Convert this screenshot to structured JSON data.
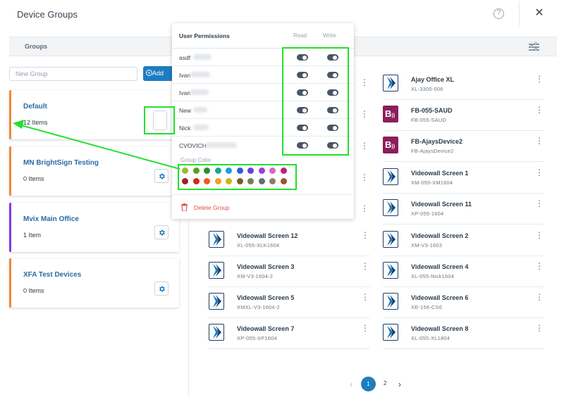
{
  "header": {
    "title": "Device Groups",
    "help_icon": "?",
    "close_icon": "✕"
  },
  "groups_band": {
    "label": "Groups"
  },
  "new_group": {
    "placeholder": "New Group",
    "add_label": "Add",
    "add_icon": "+"
  },
  "groups": [
    {
      "name": "Default",
      "count": "12 Items",
      "accent": "#f08a3c"
    },
    {
      "name": "MN BrightSign Testing",
      "count": "0 Items",
      "accent": "#f08a3c"
    },
    {
      "name": "Mvix Main Office",
      "count": "1 Item",
      "accent": "#7b3fe4"
    },
    {
      "name": "XFA Test Devices",
      "count": "0 Items",
      "accent": "#f08a3c"
    }
  ],
  "devices_left": [
    {
      "name": "Videowall Screen 12",
      "id": "XL-055-XLK1604",
      "icon": "videowall-icon"
    },
    {
      "name": "Videowall Screen 3",
      "id": "XM-V3-1604-2",
      "icon": "videowall-icon"
    },
    {
      "name": "Videowall Screen 5",
      "id": "XMXL-V3-1604-2",
      "icon": "videowall-icon"
    },
    {
      "name": "Videowall Screen 7",
      "id": "XP-055-XP1604",
      "icon": "videowall-icon"
    }
  ],
  "devices_right": [
    {
      "name": "Ajay Office XL",
      "id": "XL-3300-006",
      "icon": "videowall-icon"
    },
    {
      "name": "FB-055-SAUD",
      "id": "FB-055-SAUD",
      "icon": "brightsign-icon"
    },
    {
      "name": "FB-AjaysDevice2",
      "id": "FB-AjaysDevice2",
      "icon": "brightsign-icon"
    },
    {
      "name": "Videowall Screen 1",
      "id": "XM-055-XM1604",
      "icon": "videowall-icon"
    },
    {
      "name": "Videowall Screen 11",
      "id": "XP-055-1604",
      "icon": "videowall-icon"
    },
    {
      "name": "Videowall Screen 2",
      "id": "XM-V3-1603",
      "icon": "videowall-icon"
    },
    {
      "name": "Videowall Screen 4",
      "id": "XL-055-Nick1604",
      "icon": "videowall-icon"
    },
    {
      "name": "Videowall Screen 6",
      "id": "XE-156-CS6",
      "icon": "videowall-icon"
    },
    {
      "name": "Videowall Screen 8",
      "id": "XL-055-XL1804",
      "icon": "videowall-icon"
    }
  ],
  "kebab": "⋮",
  "pagination": {
    "prev": "‹",
    "pages": [
      "1",
      "2"
    ],
    "next": "›",
    "current": "1"
  },
  "permissions": {
    "title": "User Permissions",
    "read_header": "Read",
    "write_header": "Write",
    "users": [
      {
        "name": "asdf",
        "read": true,
        "write": true
      },
      {
        "name": "Ivan",
        "read": true,
        "write": true
      },
      {
        "name": "Ivan",
        "read": true,
        "write": true
      },
      {
        "name": "New",
        "read": true,
        "write": true
      },
      {
        "name": "Nick",
        "read": true,
        "write": true
      },
      {
        "name": "CVOVICH",
        "read": true,
        "write": true
      }
    ],
    "group_color_label": "Group Color",
    "colors_row1": [
      "#9bbb2e",
      "#5a9e1c",
      "#2e8b2e",
      "#19a89a",
      "#1e9ed8",
      "#2b5fd9",
      "#6a3fd6",
      "#9b3fd6",
      "#e060c6",
      "#c21f7a"
    ],
    "colors_row2": [
      "#9c1f2e",
      "#d6241f",
      "#ee5a1f",
      "#f2a21f",
      "#d4b017",
      "#7d5a2a",
      "#6f7f57",
      "#5d6f7d",
      "#8c7a6b",
      "#a0522d"
    ],
    "delete_label": "Delete Group"
  },
  "highlight_color": "#22e02c"
}
